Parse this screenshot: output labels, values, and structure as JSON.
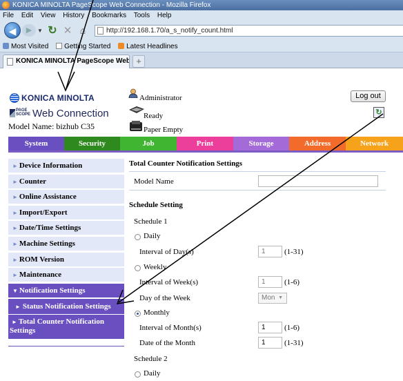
{
  "browser": {
    "window_title": "KONICA MINOLTA PageScope Web Connection - Mozilla Firefox",
    "menu": [
      "File",
      "Edit",
      "View",
      "History",
      "Bookmarks",
      "Tools",
      "Help"
    ],
    "url": "http://192.168.1.70/a_s_notify_count.html",
    "bookmarks": [
      "Most Visited",
      "Getting Started",
      "Latest Headlines"
    ],
    "tab_title": "KONICA MINOLTA PageScope Web C...",
    "new_tab": "+"
  },
  "header": {
    "brand": "KONICA MINOLTA",
    "product_mark": "PAGE SCOPE",
    "product": "Web Connection",
    "model_line": "Model Name: bizhub C35",
    "user": "Administrator",
    "status": "Ready",
    "paper_status": "Paper Empty",
    "logout_label": "Log out",
    "refresh_icon": "refresh-icon"
  },
  "main_tabs": [
    {
      "label": "System",
      "color": "#6a4fc0"
    },
    {
      "label": "Security",
      "color": "#2e8a1e"
    },
    {
      "label": "Job",
      "color": "#3fb531"
    },
    {
      "label": "Print",
      "color": "#ec3f9c"
    },
    {
      "label": "Storage",
      "color": "#a36ad8"
    },
    {
      "label": "Address",
      "color": "#f36b2a"
    },
    {
      "label": "Network",
      "color": "#f7a21b"
    }
  ],
  "sidebar": {
    "items": [
      {
        "label": "Device Information"
      },
      {
        "label": "Counter"
      },
      {
        "label": "Online Assistance"
      },
      {
        "label": "Import/Export"
      },
      {
        "label": "Date/Time Settings"
      },
      {
        "label": "Machine Settings"
      },
      {
        "label": "ROM Version"
      },
      {
        "label": "Maintenance"
      },
      {
        "label": "Notification Settings"
      }
    ],
    "sub_items": [
      {
        "label": "Status Notification Settings"
      },
      {
        "label": "Total Counter Notification Settings"
      }
    ]
  },
  "content": {
    "title": "Total Counter Notification Settings",
    "model_name_label": "Model Name",
    "model_name_value": "",
    "schedule_heading": "Schedule Setting",
    "schedule1": {
      "label": "Schedule 1",
      "daily_label": "Daily",
      "interval_day_label": "Interval of Day(s)",
      "interval_day_value": "1",
      "interval_day_range": "(1-31)",
      "weekly_label": "Weekly",
      "interval_week_label": "Interval of Week(s)",
      "interval_week_value": "1",
      "interval_week_range": "(1-6)",
      "day_of_week_label": "Day of the Week",
      "day_of_week_value": "Mon",
      "monthly_label": "Monthly",
      "interval_month_label": "Interval of Month(s)",
      "interval_month_value": "1",
      "interval_month_range": "(1-6)",
      "date_of_month_label": "Date of the Month",
      "date_of_month_value": "1",
      "date_of_month_range": "(1-31)",
      "selected": "Monthly"
    },
    "schedule2": {
      "label": "Schedule 2",
      "daily_label": "Daily"
    }
  }
}
